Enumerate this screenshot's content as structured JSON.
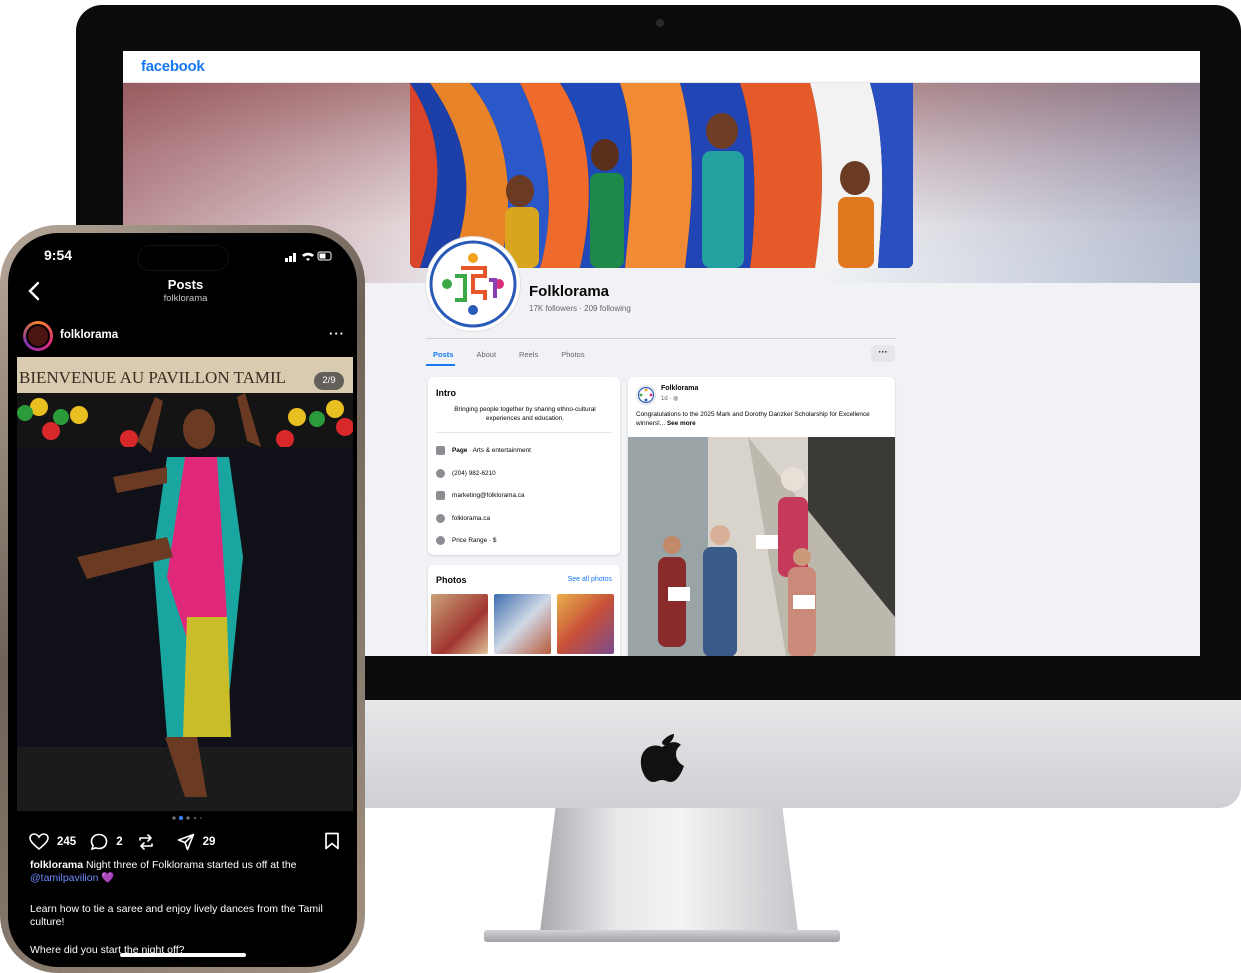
{
  "facebook": {
    "logo": "facebook",
    "page_name": "Folklorama",
    "stats": "17K followers · 209 following",
    "tabs": [
      "Posts",
      "About",
      "Reels",
      "Photos"
    ],
    "more_button": "···",
    "intro": {
      "title": "Intro",
      "bio": "Bringing people together by sharing ethno-cultural experiences and education.",
      "page_label": "Page",
      "page_category": " · Arts & entertainment",
      "phone": "(204) 982-6210",
      "email": "marketing@folklorama.ca",
      "website": "folklorama.ca",
      "price_range": "Price Range · $"
    },
    "photos": {
      "title": "Photos",
      "see_all": "See all photos"
    },
    "post": {
      "author": "Folklorama",
      "time": "1d · ◍",
      "text": "Congratulations to the 2025 Mark and Dorothy Danzker Scholarship for Excellence winners!... ",
      "see_more": "See more"
    }
  },
  "instagram": {
    "time": "9:54",
    "header_title": "Posts",
    "header_subtitle": "folklorama",
    "username": "folklorama",
    "more": "···",
    "photo_banner": "BIENVENUE AU PAVILLON TAMIL",
    "photo_counter": "2/9",
    "likes": "245",
    "comments": "2",
    "shares": "29",
    "caption_user": "folklorama",
    "caption_text": " Night three of Folklorama started us off at the ",
    "caption_mention": "@tamilpavilion",
    "caption_emoji": " 💜",
    "caption_line2": "Learn how to tie a saree and enjoy lively dances from the Tamil culture!",
    "caption_line3": "Where did you start the night off?"
  },
  "colors": {
    "facebook_blue": "#1877f2",
    "instagram_mention": "#6b8cff",
    "imac_bezel": "#0b0b0b"
  }
}
